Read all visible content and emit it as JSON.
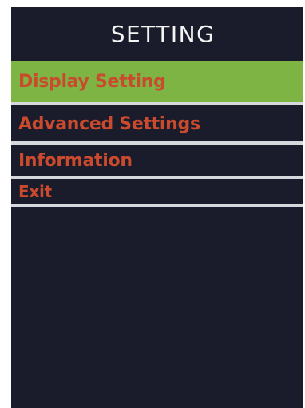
{
  "screen": {
    "title": "SETTING",
    "menu": [
      {
        "label": "Display Setting",
        "selected": true
      },
      {
        "label": "Advanced Settings",
        "selected": false
      },
      {
        "label": "Information",
        "selected": false
      },
      {
        "label": "Exit",
        "selected": false
      }
    ]
  },
  "colors": {
    "background": "#1a1c2b",
    "title_text": "#f4f4f4",
    "item_text": "#c94a2d",
    "selected_highlight": "#7db443",
    "divider": "#d6d8de"
  }
}
